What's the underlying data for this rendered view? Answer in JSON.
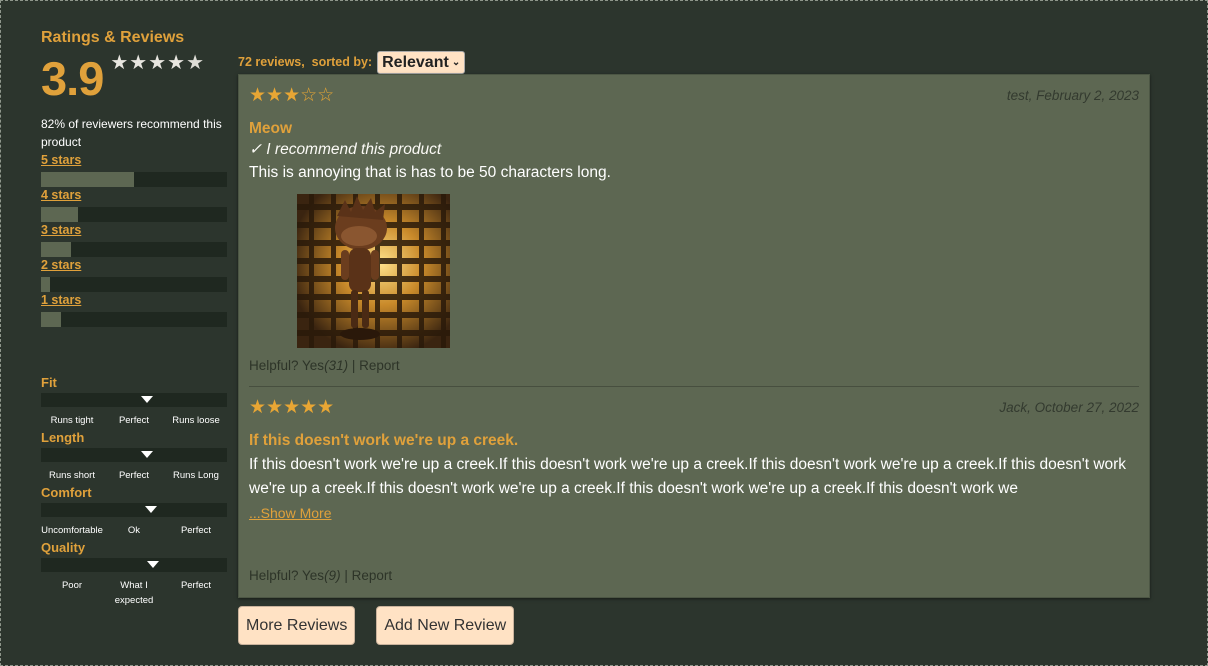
{
  "ratings": {
    "title": "Ratings & Reviews",
    "average": "3.9",
    "average_stars": {
      "full": 4,
      "empty": 1
    },
    "recommend_text": "82% of reviewers recommend this product",
    "breakdown": [
      {
        "label": "5 stars",
        "fraction": 0.5
      },
      {
        "label": "4 stars",
        "fraction": 0.2
      },
      {
        "label": "3 stars",
        "fraction": 0.16
      },
      {
        "label": "2 stars",
        "fraction": 0.05
      },
      {
        "label": "1 stars",
        "fraction": 0.11
      }
    ]
  },
  "characteristics": [
    {
      "name": "Fit",
      "value": 0.57,
      "labels": [
        "Runs tight",
        "Perfect",
        "Runs loose"
      ]
    },
    {
      "name": "Length",
      "value": 0.57,
      "labels": [
        "Runs short",
        "Perfect",
        "Runs Long"
      ]
    },
    {
      "name": "Comfort",
      "value": 0.59,
      "labels": [
        "Uncomfortable",
        "Ok",
        "Perfect"
      ]
    },
    {
      "name": "Quality",
      "value": 0.6,
      "labels": [
        "Poor",
        "What I expected",
        "Perfect"
      ]
    }
  ],
  "list": {
    "count_text": "72 reviews,",
    "sorted_by_text": "sorted by:",
    "sort_value": "Relevant"
  },
  "reviews": [
    {
      "stars": "★★★☆☆",
      "meta": "test, February 2, 2023",
      "title": "Meow",
      "recommend": "✓ I recommend this product",
      "body": "This is annoying that is has to be 50 characters long.",
      "helpful_prefix": "Helpful? Yes",
      "helpful_count": "(31)",
      "report": " | Report"
    },
    {
      "stars": "★★★★★",
      "meta": "Jack, October 27, 2022",
      "title": "If this doesn't work we're up a creek.",
      "body": "If this doesn't work we're up a creek.If this doesn't work we're up a creek.If this doesn't work we're up a creek.If this doesn't work we're up a creek.If this doesn't work we're up a creek.If this doesn't work we're up a creek.If this doesn't work we",
      "show_more": "...Show More",
      "helpful_prefix": "Helpful? Yes",
      "helpful_count": "(9)",
      "report": " | Report"
    }
  ],
  "buttons": {
    "more_reviews": "More Reviews",
    "add_review": "Add New Review"
  },
  "colors": {
    "background": "#2c352d",
    "accent": "#e0a13b",
    "panel": "#5d6752",
    "button": "#ffe2c4"
  },
  "icons": [
    "star-icon",
    "chevron-down-icon",
    "triangle-marker-icon"
  ]
}
